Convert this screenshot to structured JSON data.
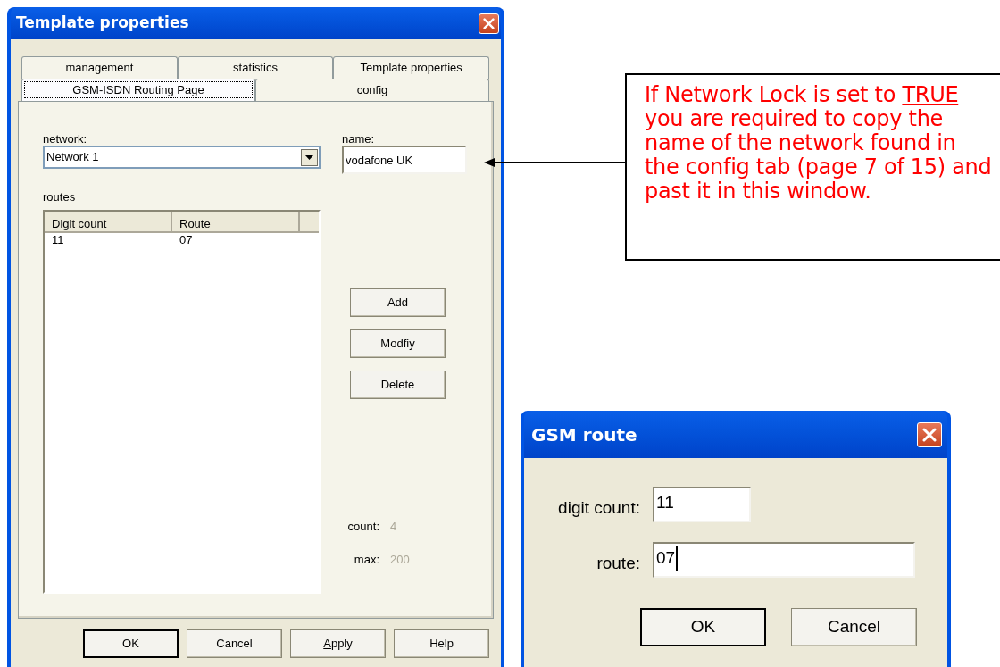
{
  "main_window": {
    "title": "Template properties",
    "tab_rows": [
      [
        {
          "label": "management",
          "selected": false
        },
        {
          "label": "statistics",
          "selected": false
        },
        {
          "label": "Template properties",
          "selected": false
        }
      ],
      [
        {
          "label": "GSM-ISDN Routing Page",
          "selected": true
        },
        {
          "label": "config",
          "selected": false
        }
      ]
    ],
    "network": {
      "label": "network:",
      "value": "Network 1"
    },
    "name": {
      "label": "name:",
      "value": "vodafone UK"
    },
    "routes": {
      "label": "routes",
      "columns": [
        "Digit count",
        "Route"
      ],
      "rows": [
        [
          "11",
          "07"
        ]
      ]
    },
    "actions": [
      "Add",
      "Modfiy",
      "Delete"
    ],
    "stats": [
      {
        "label": "count:",
        "value": "4",
        "disabled": true
      },
      {
        "label": "max:",
        "value": "200",
        "disabled": true
      }
    ],
    "buttons": [
      {
        "label": "OK",
        "default": true,
        "mnemonic": false
      },
      {
        "label": "Cancel",
        "default": false,
        "mnemonic": false
      },
      {
        "label": "Apply",
        "default": false,
        "mnemonic": true
      },
      {
        "label": "Help",
        "default": false,
        "mnemonic": false
      }
    ]
  },
  "callout": {
    "before": "If Network Lock is set to ",
    "emphasis": "TRUE",
    "after": " you are required to copy the name of the network found in the config tab (page 7 of 15) and past it in this window."
  },
  "route_dialog": {
    "title": "GSM route",
    "fields": [
      {
        "label": "digit count:",
        "value": "11",
        "focused": false
      },
      {
        "label": "route:",
        "value": "07",
        "focused": true
      }
    ],
    "buttons": [
      {
        "label": "OK",
        "default": true
      },
      {
        "label": "Cancel",
        "default": false
      }
    ]
  }
}
